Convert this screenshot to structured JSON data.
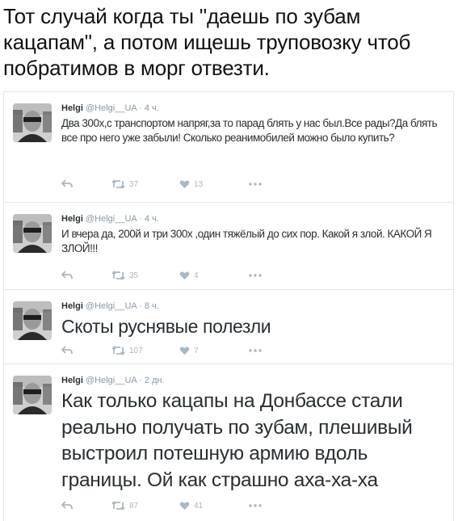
{
  "caption": "Тот случай когда ты \"даешь по зубам кацапам\", а потом ищешь труповозку чтоб побратимов в морг отвезти.",
  "tweets": [
    {
      "name": "Helgi",
      "handle": "@Helgi__UA",
      "time": "· 4 ч.",
      "text": "Два 300х,с транспортом напряг,за то парад блять у нас был.Все рады?Да блять все про него уже забыли! Сколько реанимобилей можно было купить?",
      "retweets": "37",
      "likes": "13"
    },
    {
      "name": "Helgi",
      "handle": "@Helgi__UA",
      "time": "· 4 ч.",
      "text": "И вчера да, 200й и три 300х ,один тяжёлый до сих пор. Какой я злой. КАКОЙ Я ЗЛОЙ!!!",
      "retweets": "35",
      "likes": "4"
    },
    {
      "name": "Helgi",
      "handle": "@Helgi__UA",
      "time": "· 8 ч.",
      "text": "Скоты руснявые полезли",
      "retweets": "107",
      "likes": "7"
    },
    {
      "name": "Helgi",
      "handle": "@Helgi__UA",
      "time": "· 2 дн.",
      "text": "Как только кацапы на Донбассе стали реально получать по зубам, плешивый выстроил потешную армию вдоль границы. Ой как страшно аха-ха-ха",
      "retweets": "87",
      "likes": "41"
    }
  ],
  "icons": {
    "reply": "reply-icon",
    "retweet": "retweet-icon",
    "like": "heart-icon",
    "more": "more-icon"
  },
  "colors": {
    "text": "#292f33",
    "meta": "#8899a6",
    "icon": "#aab8c2",
    "border": "#e1e8ed"
  }
}
